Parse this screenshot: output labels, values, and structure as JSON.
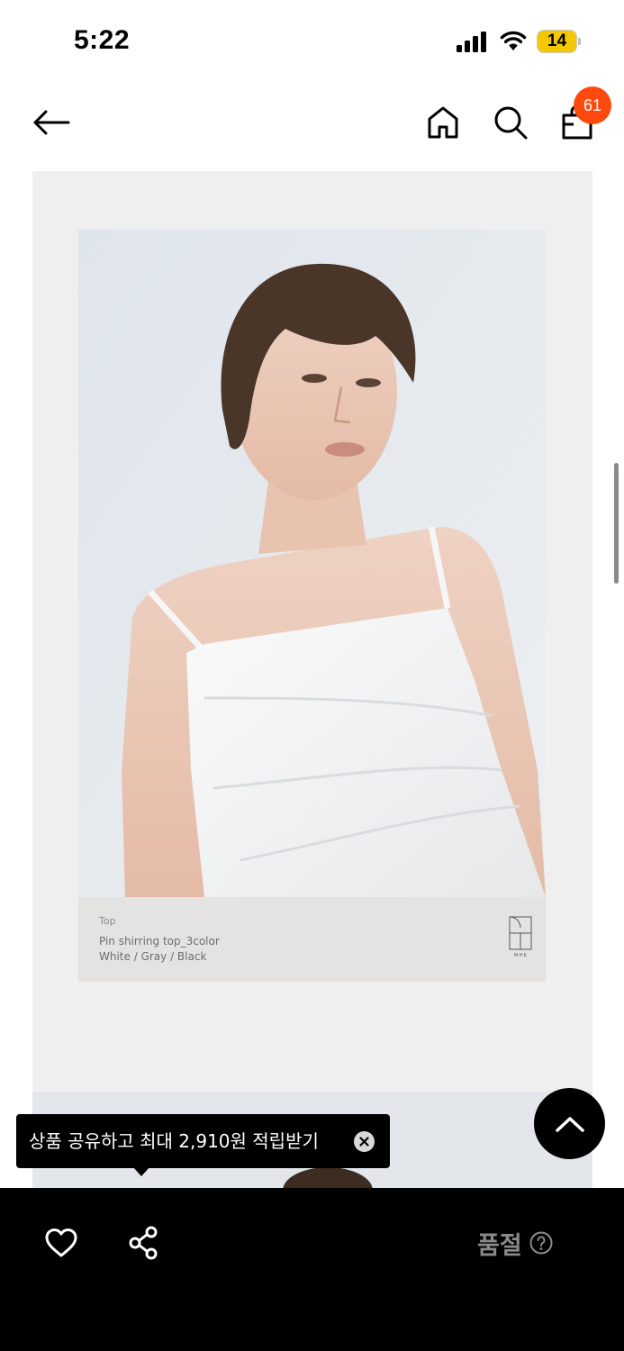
{
  "status_bar": {
    "time": "5:22",
    "battery_level": "14",
    "battery_color": "#f3c800"
  },
  "nav": {
    "back_icon": "arrow-left-icon",
    "home_icon": "home-icon",
    "search_icon": "search-icon",
    "cart_icon": "shopping-bag-icon",
    "cart_count": "61",
    "badge_color": "#ff4a0f"
  },
  "product_card": {
    "category": "Top",
    "name": "Pin shirring top_3color",
    "colors": "White / Gray / Black",
    "brand_logo_text": "M H E"
  },
  "share_tooltip": {
    "text": "상품 공유하고 최대 2,910원 적립받기",
    "close_icon": "close-circle-icon"
  },
  "scroll_top": {
    "icon": "chevron-up-icon"
  },
  "bottom_bar": {
    "wishlist_icon": "heart-outline-icon",
    "share_icon": "share-icon",
    "status_label": "품절",
    "help_icon": "question-circle-icon"
  }
}
